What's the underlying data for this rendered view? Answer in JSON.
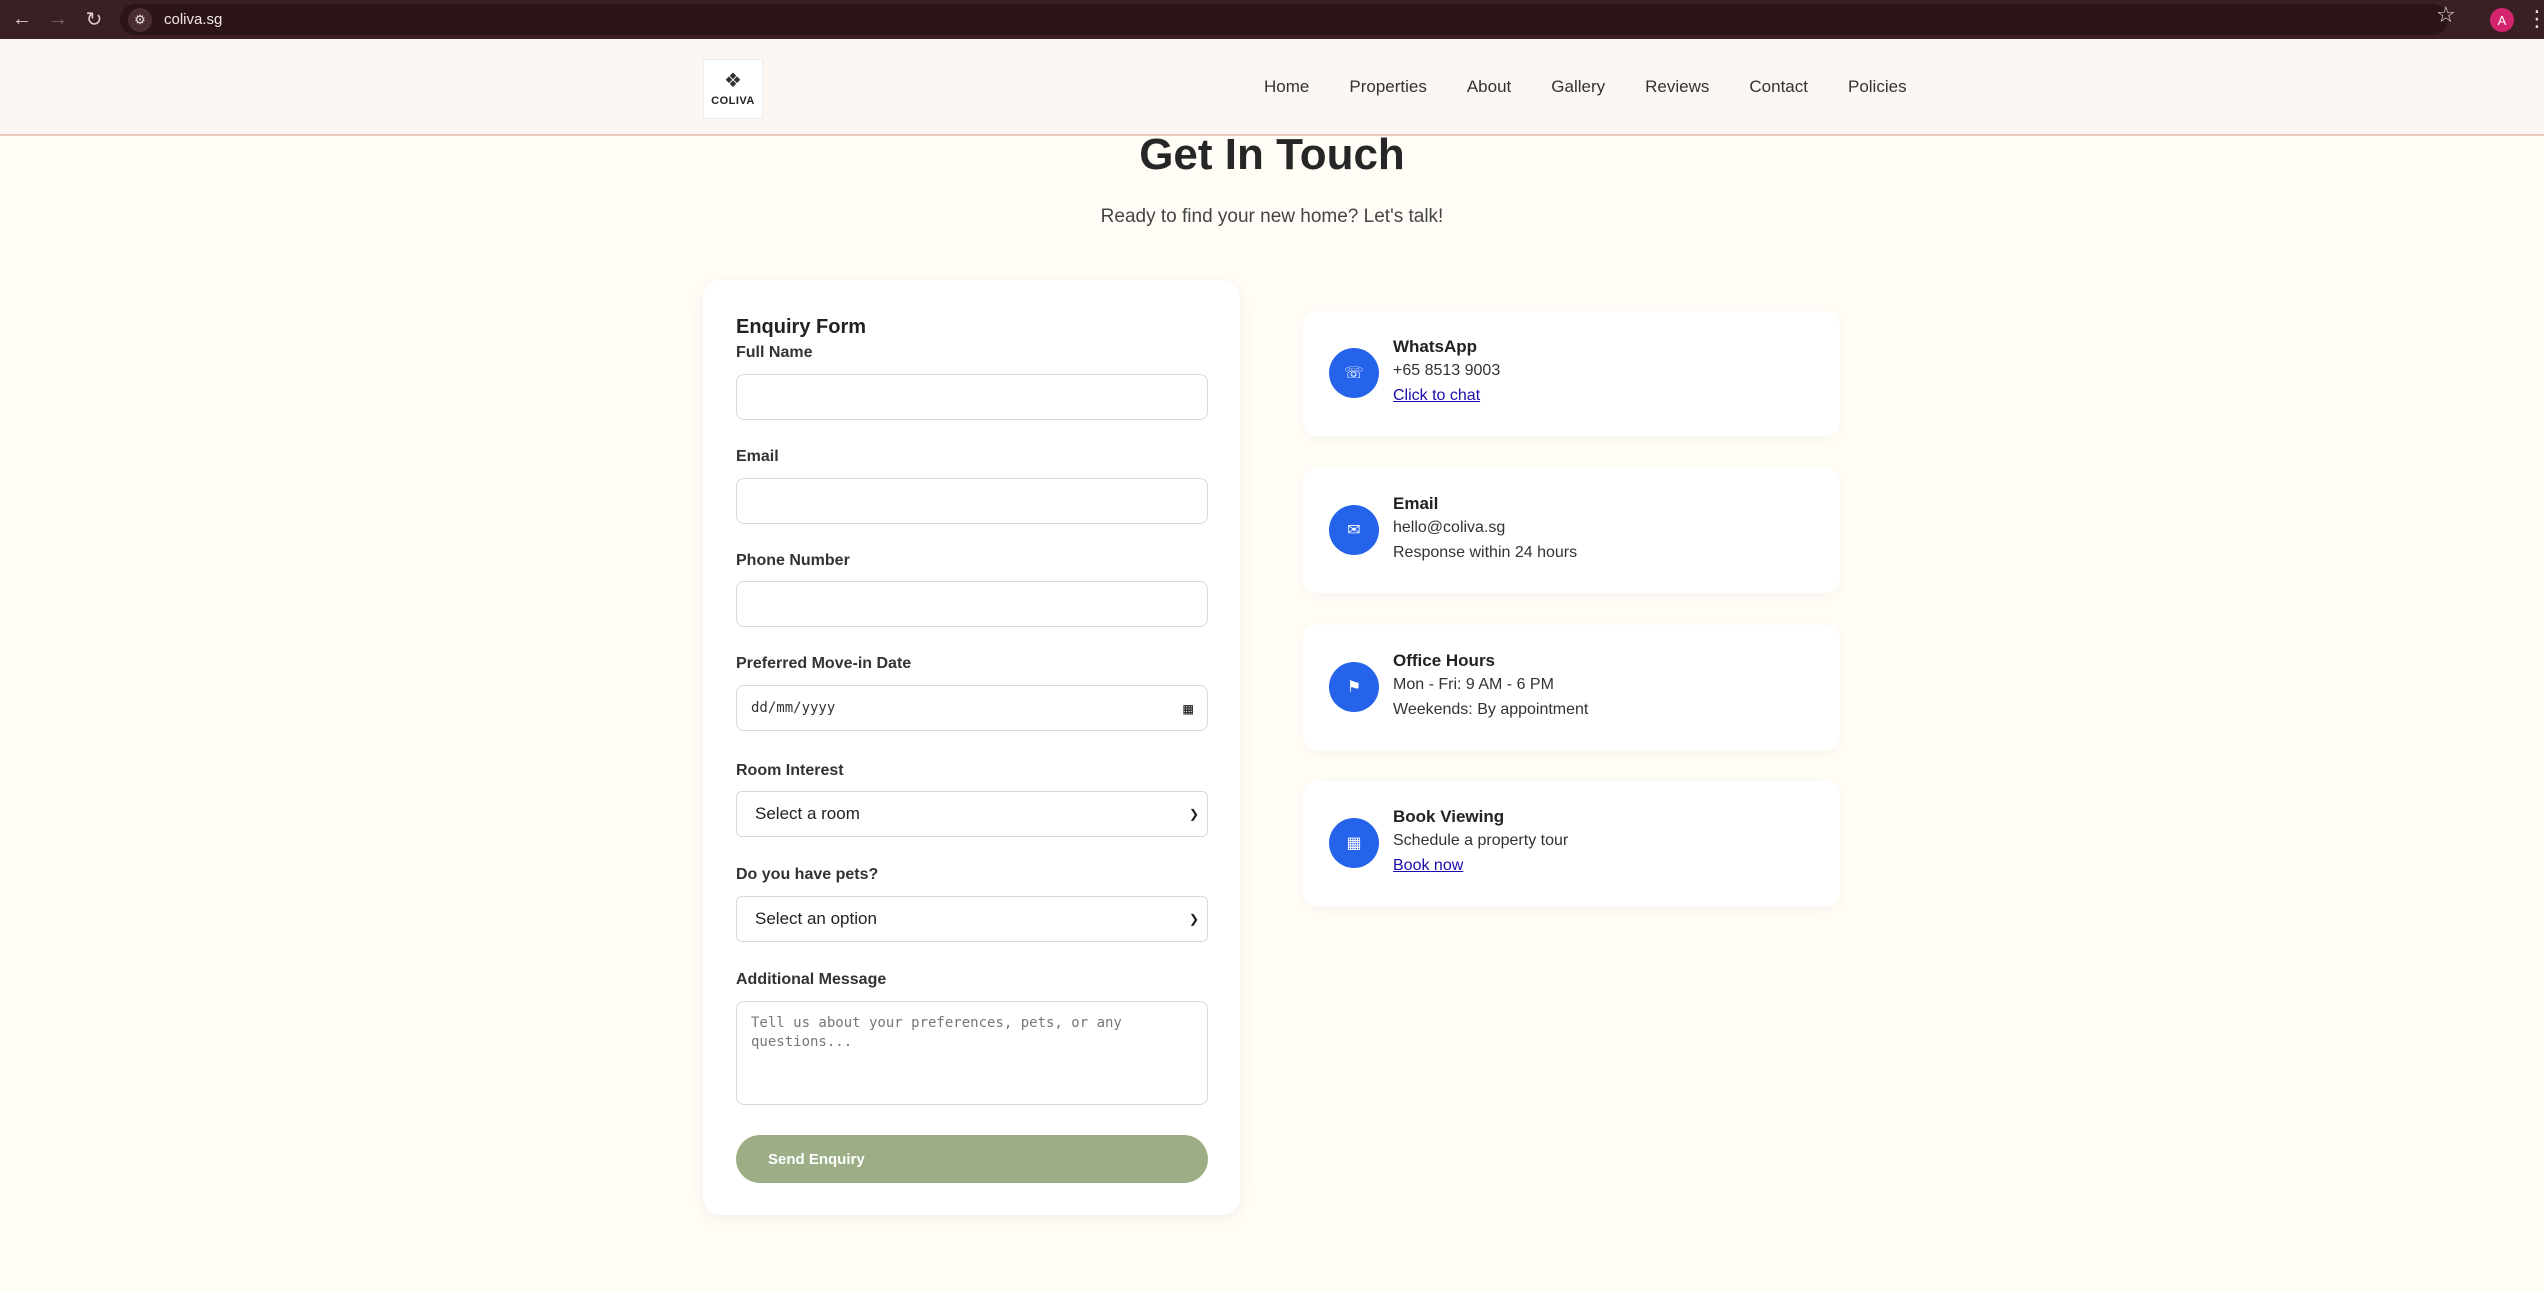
{
  "browser": {
    "url": "coliva.sg",
    "profile_initial": "A"
  },
  "header": {
    "logo_text": "COLIVA",
    "nav": [
      "Home",
      "Properties",
      "About",
      "Gallery",
      "Reviews",
      "Contact",
      "Policies"
    ]
  },
  "hero": {
    "title": "Get In Touch",
    "subtitle": "Ready to find your new home? Let's talk!"
  },
  "form": {
    "title": "Enquiry Form",
    "full_name_label": "Full Name",
    "email_label": "Email",
    "phone_label": "Phone Number",
    "move_in_label": "Preferred Move-in Date",
    "move_in_placeholder": "dd/mm/yyyy",
    "room_label": "Room Interest",
    "room_selected": "Select a room",
    "pets_label": "Do you have pets?",
    "pets_selected": "Select an option",
    "message_label": "Additional Message",
    "message_placeholder": "Tell us about your preferences, pets, or any questions...",
    "submit_label": "Send Enquiry"
  },
  "contact_cards": [
    {
      "title": "WhatsApp",
      "line1": "+65 8513 9003",
      "line2": "Click to chat",
      "icon": "phone-icon"
    },
    {
      "title": "Email",
      "line1": "hello@coliva.sg",
      "line2": "Response within 24 hours",
      "icon": "mail-icon"
    },
    {
      "title": "Office Hours",
      "line1": "Mon - Fri: 9 AM - 6 PM",
      "line2": "Weekends: By appointment",
      "icon": "pin-icon"
    },
    {
      "title": "Book Viewing",
      "line1": "Schedule a property tour",
      "line2": "Book now",
      "icon": "calendar-icon"
    }
  ],
  "colors": {
    "accent_blue": "#2563eb",
    "button_green": "#9dae86",
    "page_bg": "#fffdf6",
    "chrome_bg": "#3a1f24"
  }
}
